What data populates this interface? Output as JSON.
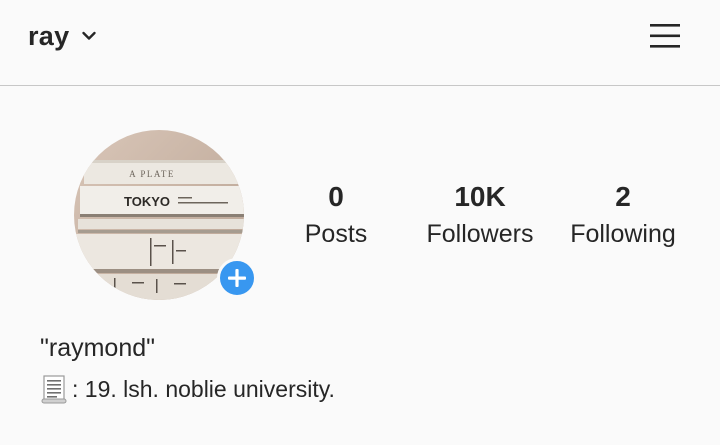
{
  "header": {
    "username": "ray",
    "chevron_icon": "chevron-down-icon",
    "menu_icon": "hamburger-menu-icon"
  },
  "profile": {
    "avatar_book_titles": [
      "A PLATE",
      "TOKYO"
    ],
    "stats": [
      {
        "value": "0",
        "label": "Posts"
      },
      {
        "value": "10K",
        "label": "Followers"
      },
      {
        "value": "2",
        "label": "Following"
      }
    ],
    "full_name": "\"raymond\"",
    "bio_icon": "scroll-icon",
    "bio_text": ": 19. lsh. noblie university."
  },
  "colors": {
    "background": "#fafafa",
    "text": "#262626",
    "divider": "#c7c7c7",
    "add_story_blue": "#3897f0"
  }
}
